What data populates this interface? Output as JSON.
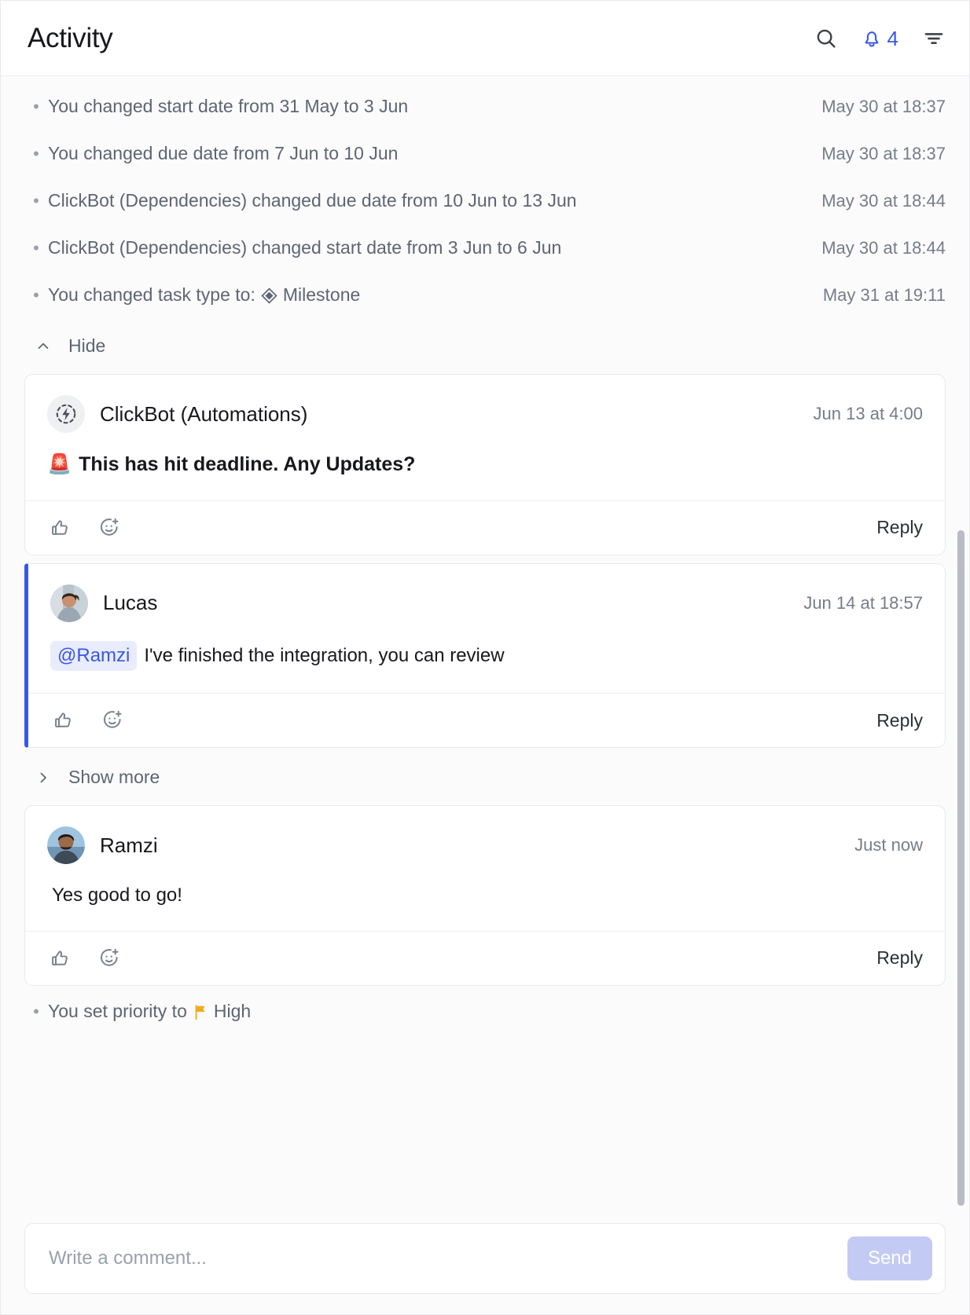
{
  "header": {
    "title": "Activity",
    "search_icon": "search-icon",
    "bell_icon": "bell-icon",
    "notification_count": "4",
    "filter_icon": "filter-icon"
  },
  "activity_log": [
    {
      "text": "You changed start date from 31 May to 3 Jun",
      "time": "May 30 at 18:37",
      "icon": null,
      "icon_label": null
    },
    {
      "text": "You changed due date from 7 Jun to 10 Jun",
      "time": "May 30 at 18:37",
      "icon": null,
      "icon_label": null
    },
    {
      "text": "ClickBot (Dependencies) changed due date from 10 Jun to 13 Jun",
      "time": "May 30 at 18:44",
      "icon": null,
      "icon_label": null
    },
    {
      "text": "ClickBot (Dependencies) changed start date from 3 Jun to 6 Jun",
      "time": "May 30 at 18:44",
      "icon": null,
      "icon_label": null
    },
    {
      "text": "You changed task type to:",
      "time": "May 31 at 19:11",
      "icon": "milestone-icon",
      "icon_label": "Milestone"
    }
  ],
  "hide_toggle": {
    "label": "Hide",
    "icon": "chevron-up-icon"
  },
  "show_more_toggle": {
    "label": "Show more",
    "icon": "chevron-right-icon"
  },
  "comments": [
    {
      "author": "ClickBot (Automations)",
      "avatar": "clickbot-avatar",
      "time": "Jun 13 at 4:00",
      "emoji": "🚨",
      "text": "This has hit deadline. Any Updates?",
      "bold": true,
      "mention": null,
      "highlighted": false,
      "thumbs_icon": "thumbs-up-icon",
      "emoji_icon": "add-reaction-icon",
      "reply_label": "Reply"
    },
    {
      "author": "Lucas",
      "avatar": "lucas-avatar",
      "time": "Jun 14 at 18:57",
      "emoji": null,
      "text": "I've finished the integration, you can review",
      "bold": false,
      "mention": "@Ramzi",
      "highlighted": true,
      "thumbs_icon": "thumbs-up-icon",
      "emoji_icon": "add-reaction-icon",
      "reply_label": "Reply"
    },
    {
      "author": "Ramzi",
      "avatar": "ramzi-avatar",
      "time": "Just now",
      "emoji": null,
      "text": "Yes good to go!",
      "bold": false,
      "mention": null,
      "highlighted": false,
      "thumbs_icon": "thumbs-up-icon",
      "emoji_icon": "add-reaction-icon",
      "reply_label": "Reply"
    }
  ],
  "priority_row": {
    "text": "You set priority to",
    "icon": "flag-icon",
    "value": "High"
  },
  "composer": {
    "placeholder": "Write a comment...",
    "value": "",
    "send_label": "Send"
  },
  "colors": {
    "accent": "#3b57e0",
    "mention_bg": "#e8ecfd",
    "send_bg": "#c3cbf5",
    "flag": "#f2a91b",
    "muted_text": "#5e6472"
  }
}
